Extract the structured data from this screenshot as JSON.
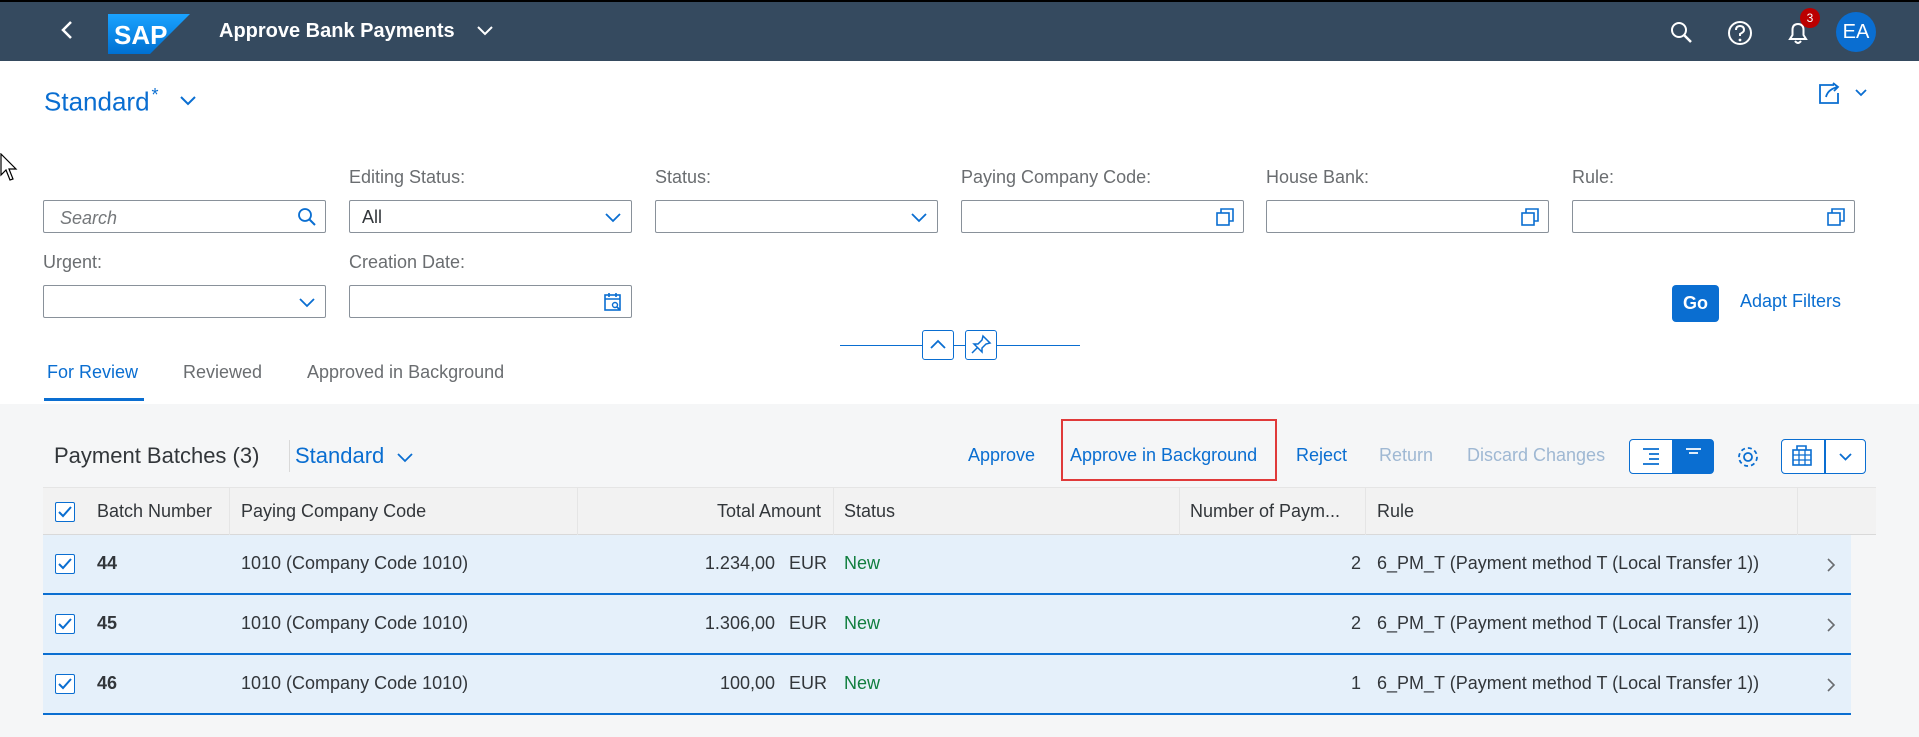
{
  "shell": {
    "logo_text": "SAP",
    "app_title": "Approve Bank Payments",
    "notification_count": "3",
    "user_initials": "EA"
  },
  "header": {
    "variant": "Standard",
    "variant_modified": "*"
  },
  "filters": {
    "search_placeholder": "Search",
    "editing_status_label": "Editing Status:",
    "editing_status_value": "All",
    "status_label": "Status:",
    "paying_company_code_label": "Paying Company Code:",
    "house_bank_label": "House Bank:",
    "rule_label": "Rule:",
    "urgent_label": "Urgent:",
    "creation_date_label": "Creation Date:",
    "go_label": "Go",
    "adapt_filters_label": "Adapt Filters"
  },
  "tabs": [
    {
      "label": "For Review",
      "active": true
    },
    {
      "label": "Reviewed",
      "active": false
    },
    {
      "label": "Approved in Background",
      "active": false
    }
  ],
  "table_toolbar": {
    "title": "Payment Batches (3)",
    "variant": "Standard",
    "approve": "Approve",
    "approve_background": "Approve in Background",
    "reject": "Reject",
    "return": "Return",
    "discard": "Discard Changes"
  },
  "table": {
    "columns": [
      "Batch Number",
      "Paying Company Code",
      "Total Amount",
      "Status",
      "Number of Paym...",
      "Rule"
    ],
    "rows": [
      {
        "batch": "44",
        "company": "1010 (Company Code 1010)",
        "amount": "1.234,00",
        "currency": "EUR",
        "status": "New",
        "count": "2",
        "rule": "6_PM_T (Payment method T (Local Transfer 1))"
      },
      {
        "batch": "45",
        "company": "1010 (Company Code 1010)",
        "amount": "1.306,00",
        "currency": "EUR",
        "status": "New",
        "count": "2",
        "rule": "6_PM_T (Payment method T (Local Transfer 1))"
      },
      {
        "batch": "46",
        "company": "1010 (Company Code 1010)",
        "amount": "100,00",
        "currency": "EUR",
        "status": "New",
        "count": "1",
        "rule": "6_PM_T (Payment method T (Local Transfer 1))"
      }
    ]
  },
  "colors": {
    "shell_bg": "#354a5f",
    "brand_blue": "#0a6ed1",
    "status_green": "#107e3e",
    "highlight_red": "#e03a3a",
    "selected_row": "#e5f0fa"
  }
}
